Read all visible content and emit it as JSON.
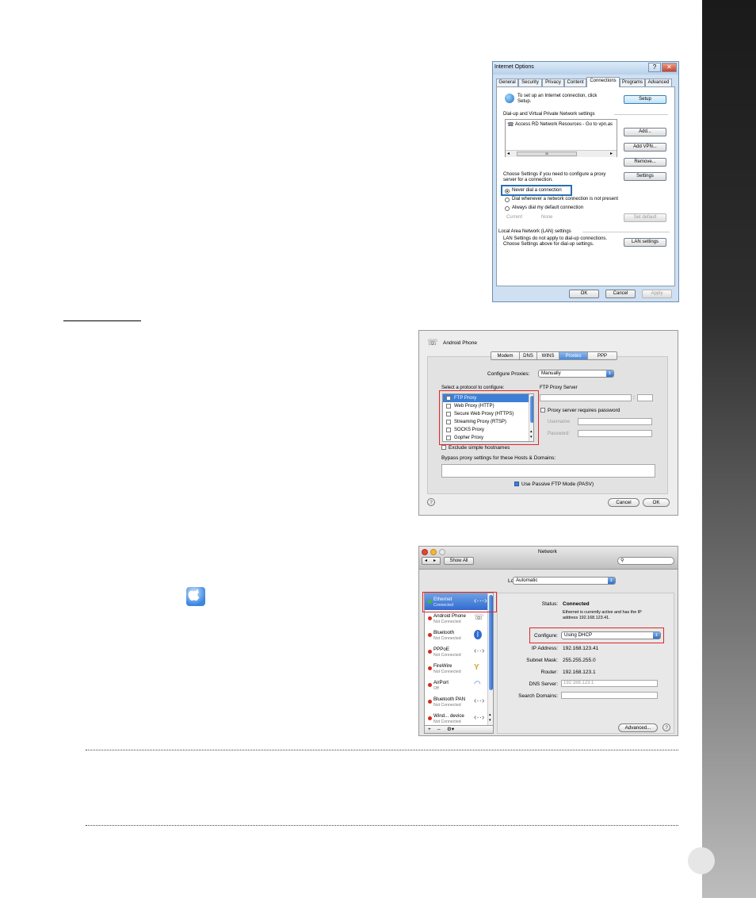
{
  "page": {
    "number": ""
  },
  "internet_options": {
    "title": "Internet Options",
    "help_symbol": "?",
    "close_symbol": "✕",
    "tabs": [
      "General",
      "Security",
      "Privacy",
      "Content",
      "Connections",
      "Programs",
      "Advanced"
    ],
    "active_tab": "Connections",
    "setup_text_1": "To set up an Internet connection, click",
    "setup_text_2": "Setup.",
    "setup_button": "Setup",
    "vpn_section": "Dial-up and Virtual Private Network settings",
    "vpn_item": "Access RD Network Resources - Go to vpn.as",
    "scroll_mid": "III",
    "add_button": "Add...",
    "add_vpn_button": "Add VPN...",
    "remove_button": "Remove...",
    "settings_text_1": "Choose Settings if you need to configure a proxy",
    "settings_text_2": "server for a connection.",
    "settings_button": "Settings",
    "radio_never": "Never dial a connection",
    "radio_whenever": "Dial whenever a network connection is not present",
    "radio_always": "Always dial my default connection",
    "current_label": "Current",
    "current_value": "None",
    "set_default_button": "Set default",
    "lan_section": "Local Area Network (LAN) settings",
    "lan_text_1": "LAN Settings do not apply to dial-up connections.",
    "lan_text_2": "Choose Settings above for dial-up settings.",
    "lan_button": "LAN settings",
    "ok_button": "OK",
    "cancel_button": "Cancel",
    "apply_button": "Apply"
  },
  "proxies": {
    "title": "Android Phone",
    "tabs": [
      "Modem",
      "DNS",
      "WINS",
      "Proxies",
      "PPP"
    ],
    "active_tab": "Proxies",
    "configure_label": "Configure Proxies:",
    "configure_value": "Manually",
    "select_label": "Select a protocol to configure:",
    "protocols": [
      "FTP Proxy",
      "Web Proxy (HTTP)",
      "Secure Web Proxy (HTTPS)",
      "Streaming Proxy (RTSP)",
      "SOCKS Proxy",
      "Gopher Proxy"
    ],
    "server_label": "FTP Proxy Server",
    "colon": ":",
    "requires_password": "Proxy server requires password",
    "username_label": "Username:",
    "password_label": "Password:",
    "exclude_label": "Exclude simple hostnames",
    "bypass_label": "Bypass proxy settings for these Hosts & Domains:",
    "pasv_label": "Use Passive FTP Mode (PASV)",
    "help_symbol": "?",
    "cancel_button": "Cancel",
    "ok_button": "OK"
  },
  "network": {
    "title": "Network",
    "show_all": "Show All",
    "location_label": "Location:",
    "location_value": "Automatic",
    "services": [
      {
        "name": "Ethernet",
        "status": "Connected",
        "icon": "‹···›"
      },
      {
        "name": "Android Phone",
        "status": "Not Connected",
        "icon": "☏"
      },
      {
        "name": "Bluetooth",
        "status": "Not Connected",
        "icon": "ᛒ"
      },
      {
        "name": "PPPoE",
        "status": "Not Connected",
        "icon": "‹··›"
      },
      {
        "name": "FireWire",
        "status": "Not Connected",
        "icon": "Y"
      },
      {
        "name": "AirPort",
        "status": "Off",
        "icon": "◠"
      },
      {
        "name": "Bluetooth PAN",
        "status": "Not Connected",
        "icon": "‹··›"
      },
      {
        "name": "Wind... device",
        "status": "Not Connected",
        "icon": "‹··›"
      }
    ],
    "status_label": "Status:",
    "status_value": "Connected",
    "status_desc_1": "Ethernet  is currently active and has the IP",
    "status_desc_2": "address 192.168.123.41.",
    "configure_label": "Configure:",
    "configure_value": "Using DHCP",
    "ip_label": "IP Address:",
    "ip_value": "192.168.123.41",
    "subnet_label": "Subnet Mask:",
    "subnet_value": "255.255.255.0",
    "router_label": "Router:",
    "router_value": "192.168.123.1",
    "dns_label": "DNS Server:",
    "dns_value": "192.168.123.1",
    "search_label": "Search Domains:",
    "advanced_button": "Advanced...",
    "help_symbol": "?",
    "add_symbol": "+",
    "remove_symbol": "–",
    "gear_symbol": "⚙▾"
  }
}
